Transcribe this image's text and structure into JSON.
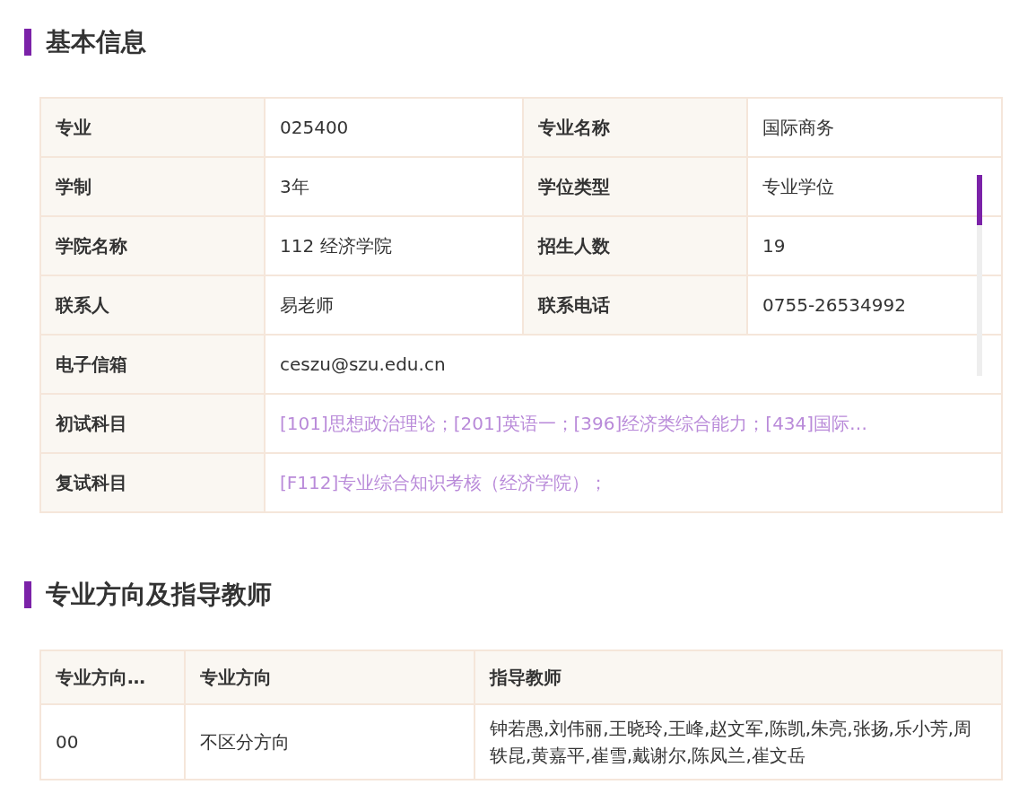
{
  "sections": [
    {
      "kind": "info",
      "title": "基本信息",
      "rows": [
        {
          "cells": [
            {
              "label": "专业",
              "value": "025400",
              "kind": "text"
            },
            {
              "label": "专业名称",
              "value": "国际商务",
              "kind": "text"
            }
          ]
        },
        {
          "cells": [
            {
              "label": "学制",
              "value": "3年",
              "kind": "text"
            },
            {
              "label": "学位类型",
              "value": "专业学位",
              "kind": "text"
            }
          ]
        },
        {
          "cells": [
            {
              "label": "学院名称",
              "value": "112 经济学院",
              "kind": "text"
            },
            {
              "label": "招生人数",
              "value": "19",
              "kind": "text"
            }
          ]
        },
        {
          "cells": [
            {
              "label": "联系人",
              "value": "易老师",
              "kind": "text"
            },
            {
              "label": "联系电话",
              "value": "0755-26534992",
              "kind": "text"
            }
          ]
        },
        {
          "cells": [
            {
              "label": "电子信箱",
              "value": "ceszu@szu.edu.cn",
              "kind": "text"
            }
          ]
        },
        {
          "cells": [
            {
              "label": "初试科目",
              "value": "[101]思想政治理论；[201]英语一；[396]经济类综合能力；[434]国际…",
              "kind": "link"
            }
          ]
        },
        {
          "cells": [
            {
              "label": "复试科目",
              "value": "[F112]专业综合知识考核（经济学院）；",
              "kind": "link"
            }
          ]
        }
      ]
    },
    {
      "kind": "table",
      "title": "专业方向及指导教师",
      "columns": [
        "专业方向…",
        "专业方向",
        "指导教师"
      ],
      "rows": [
        [
          "00",
          "不区分方向",
          "钟若愚,刘伟丽,王晓玲,王峰,赵文军,陈凯,朱亮,张扬,乐小芳,周轶昆,黄嘉平,崔雪,戴谢尔,陈凤兰,崔文岳"
        ]
      ]
    }
  ]
}
